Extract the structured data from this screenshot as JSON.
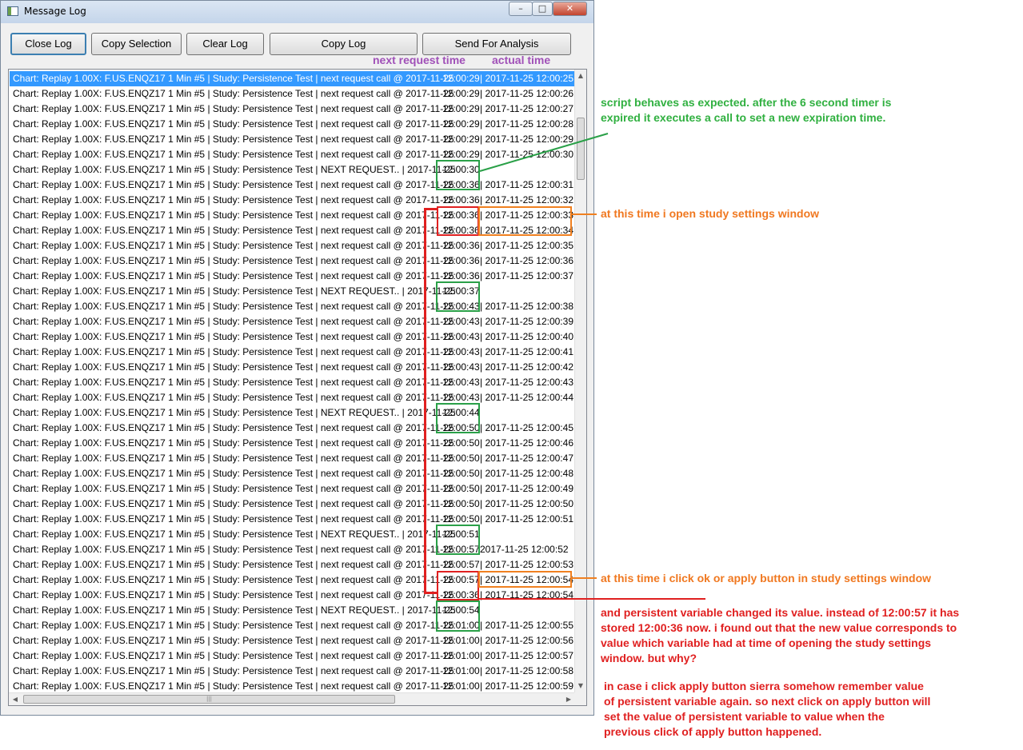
{
  "window": {
    "title": "Message Log",
    "minimize": "–",
    "maximize": "□",
    "close": "✕"
  },
  "toolbar": {
    "close_log": "Close Log",
    "copy_selection": "Copy Selection",
    "clear_log": "Clear Log",
    "copy_log": "Copy Log",
    "send_for_analysis": "Send For Analysis"
  },
  "column_annotations": {
    "next_request_time": "next request time",
    "actual_time": "actual time"
  },
  "log": {
    "rows": [
      {
        "p": "Chart: Replay 1.00X: F.US.ENQZ17  1 Min   #5 | Study: Persistence Test | next request call @ 2017-11-25",
        "t1": "12:00:29",
        "t2": "| 2017-11-25  12:00:25",
        "sel": true
      },
      {
        "p": "Chart: Replay 1.00X: F.US.ENQZ17  1 Min   #5 | Study: Persistence Test | next request call @ 2017-11-25",
        "t1": "12:00:29",
        "t2": "| 2017-11-25  12:00:26"
      },
      {
        "p": "Chart: Replay 1.00X: F.US.ENQZ17  1 Min   #5 | Study: Persistence Test | next request call @ 2017-11-25",
        "t1": "12:00:29",
        "t2": "| 2017-11-25  12:00:27"
      },
      {
        "p": "Chart: Replay 1.00X: F.US.ENQZ17  1 Min   #5 | Study: Persistence Test | next request call @ 2017-11-25",
        "t1": "12:00:29",
        "t2": "| 2017-11-25  12:00:28"
      },
      {
        "p": "Chart: Replay 1.00X: F.US.ENQZ17  1 Min   #5 | Study: Persistence Test | next request call @ 2017-11-25",
        "t1": "12:00:29",
        "t2": "| 2017-11-25  12:00:29"
      },
      {
        "p": "Chart: Replay 1.00X: F.US.ENQZ17  1 Min   #5 | Study: Persistence Test | next request call @ 2017-11-25",
        "t1": "12:00:29",
        "t2": "| 2017-11-25  12:00:30"
      },
      {
        "p": "Chart: Replay 1.00X: F.US.ENQZ17  1 Min   #5 | Study: Persistence Test | NEXT REQUEST..  | 2017-11-25",
        "t1": "12:00:30",
        "t2": ""
      },
      {
        "p": "Chart: Replay 1.00X: F.US.ENQZ17  1 Min   #5 | Study: Persistence Test | next request call @ 2017-11-25",
        "t1": "12:00:36",
        "t2": "| 2017-11-25  12:00:31"
      },
      {
        "p": "Chart: Replay 1.00X: F.US.ENQZ17  1 Min   #5 | Study: Persistence Test | next request call @ 2017-11-25",
        "t1": "12:00:36",
        "t2": "| 2017-11-25  12:00:32"
      },
      {
        "p": "Chart: Replay 1.00X: F.US.ENQZ17  1 Min   #5 | Study: Persistence Test | next request call @ 2017-11-25",
        "t1": "12:00:36",
        "t2": "| 2017-11-25  12:00:33"
      },
      {
        "p": "Chart: Replay 1.00X: F.US.ENQZ17  1 Min   #5 | Study: Persistence Test | next request call @ 2017-11-25",
        "t1": "12:00:36",
        "t2": "| 2017-11-25  12:00:34"
      },
      {
        "p": "Chart: Replay 1.00X: F.US.ENQZ17  1 Min   #5 | Study: Persistence Test | next request call @ 2017-11-25",
        "t1": "12:00:36",
        "t2": "| 2017-11-25  12:00:35"
      },
      {
        "p": "Chart: Replay 1.00X: F.US.ENQZ17  1 Min   #5 | Study: Persistence Test | next request call @ 2017-11-25",
        "t1": "12:00:36",
        "t2": "| 2017-11-25  12:00:36"
      },
      {
        "p": "Chart: Replay 1.00X: F.US.ENQZ17  1 Min   #5 | Study: Persistence Test | next request call @ 2017-11-25",
        "t1": "12:00:36",
        "t2": "| 2017-11-25  12:00:37"
      },
      {
        "p": "Chart: Replay 1.00X: F.US.ENQZ17  1 Min   #5 | Study: Persistence Test | NEXT REQUEST..  | 2017-11-25",
        "t1": "12:00:37",
        "t2": ""
      },
      {
        "p": "Chart: Replay 1.00X: F.US.ENQZ17  1 Min   #5 | Study: Persistence Test | next request call @ 2017-11-25",
        "t1": "12:00:43",
        "t2": "| 2017-11-25  12:00:38"
      },
      {
        "p": "Chart: Replay 1.00X: F.US.ENQZ17  1 Min   #5 | Study: Persistence Test | next request call @ 2017-11-25",
        "t1": "12:00:43",
        "t2": "| 2017-11-25  12:00:39"
      },
      {
        "p": "Chart: Replay 1.00X: F.US.ENQZ17  1 Min   #5 | Study: Persistence Test | next request call @ 2017-11-25",
        "t1": "12:00:43",
        "t2": "| 2017-11-25  12:00:40"
      },
      {
        "p": "Chart: Replay 1.00X: F.US.ENQZ17  1 Min   #5 | Study: Persistence Test | next request call @ 2017-11-25",
        "t1": "12:00:43",
        "t2": "| 2017-11-25  12:00:41"
      },
      {
        "p": "Chart: Replay 1.00X: F.US.ENQZ17  1 Min   #5 | Study: Persistence Test | next request call @ 2017-11-25",
        "t1": "12:00:43",
        "t2": "| 2017-11-25  12:00:42"
      },
      {
        "p": "Chart: Replay 1.00X: F.US.ENQZ17  1 Min   #5 | Study: Persistence Test | next request call @ 2017-11-25",
        "t1": "12:00:43",
        "t2": "| 2017-11-25  12:00:43"
      },
      {
        "p": "Chart: Replay 1.00X: F.US.ENQZ17  1 Min   #5 | Study: Persistence Test | next request call @ 2017-11-25",
        "t1": "12:00:43",
        "t2": "| 2017-11-25  12:00:44"
      },
      {
        "p": "Chart: Replay 1.00X: F.US.ENQZ17  1 Min   #5 | Study: Persistence Test | NEXT REQUEST..  | 2017-11-25",
        "t1": "12:00:44",
        "t2": ""
      },
      {
        "p": "Chart: Replay 1.00X: F.US.ENQZ17  1 Min   #5 | Study: Persistence Test | next request call @ 2017-11-25",
        "t1": "12:00:50",
        "t2": "| 2017-11-25  12:00:45"
      },
      {
        "p": "Chart: Replay 1.00X: F.US.ENQZ17  1 Min   #5 | Study: Persistence Test | next request call @ 2017-11-25",
        "t1": "12:00:50",
        "t2": "| 2017-11-25  12:00:46"
      },
      {
        "p": "Chart: Replay 1.00X: F.US.ENQZ17  1 Min   #5 | Study: Persistence Test | next request call @ 2017-11-25",
        "t1": "12:00:50",
        "t2": "| 2017-11-25  12:00:47"
      },
      {
        "p": "Chart: Replay 1.00X: F.US.ENQZ17  1 Min   #5 | Study: Persistence Test | next request call @ 2017-11-25",
        "t1": "12:00:50",
        "t2": "| 2017-11-25  12:00:48"
      },
      {
        "p": "Chart: Replay 1.00X: F.US.ENQZ17  1 Min   #5 | Study: Persistence Test | next request call @ 2017-11-25",
        "t1": "12:00:50",
        "t2": "| 2017-11-25  12:00:49"
      },
      {
        "p": "Chart: Replay 1.00X: F.US.ENQZ17  1 Min   #5 | Study: Persistence Test | next request call @ 2017-11-25",
        "t1": "12:00:50",
        "t2": "| 2017-11-25  12:00:50"
      },
      {
        "p": "Chart: Replay 1.00X: F.US.ENQZ17  1 Min   #5 | Study: Persistence Test | next request call @ 2017-11-25",
        "t1": "12:00:50",
        "t2": "| 2017-11-25  12:00:51"
      },
      {
        "p": "Chart: Replay 1.00X: F.US.ENQZ17  1 Min   #5 | Study: Persistence Test | NEXT REQUEST..  | 2017-11-25",
        "t1": "12:00:51",
        "t2": ""
      },
      {
        "p": "Chart: Replay 1.00X: F.US.ENQZ17  1 Min   #5 | Study: Persistence Test | next request call @ 2017-11-25",
        "t1": "12:00:57",
        "t2": "  2017-11-25  12:00:52"
      },
      {
        "p": "Chart: Replay 1.00X: F.US.ENQZ17  1 Min   #5 | Study: Persistence Test | next request call @ 2017-11-25",
        "t1": "12:00:57",
        "t2": "| 2017-11-25  12:00:53"
      },
      {
        "p": "Chart: Replay 1.00X: F.US.ENQZ17  1 Min   #5 | Study: Persistence Test | next request call @ 2017-11-25",
        "t1": "12:00:57",
        "t2": "| 2017-11-25  12:00:54"
      },
      {
        "p": "Chart: Replay 1.00X: F.US.ENQZ17  1 Min   #5 | Study: Persistence Test | next request call @ 2017-11-25",
        "t1": "12:00:36",
        "t2": "| 2017-11-25  12:00:54"
      },
      {
        "p": "Chart: Replay 1.00X: F.US.ENQZ17  1 Min   #5 | Study: Persistence Test | NEXT REQUEST..  | 2017-11-25",
        "t1": "12:00:54",
        "t2": ""
      },
      {
        "p": "Chart: Replay 1.00X: F.US.ENQZ17  1 Min   #5 | Study: Persistence Test | next request call @ 2017-11-25",
        "t1": "12:01:00",
        "t2": "| 2017-11-25  12:00:55"
      },
      {
        "p": "Chart: Replay 1.00X: F.US.ENQZ17  1 Min   #5 | Study: Persistence Test | next request call @ 2017-11-25",
        "t1": "12:01:00",
        "t2": "| 2017-11-25  12:00:56"
      },
      {
        "p": "Chart: Replay 1.00X: F.US.ENQZ17  1 Min   #5 | Study: Persistence Test | next request call @ 2017-11-25",
        "t1": "12:01:00",
        "t2": "| 2017-11-25  12:00:57"
      },
      {
        "p": "Chart: Replay 1.00X: F.US.ENQZ17  1 Min   #5 | Study: Persistence Test | next request call @ 2017-11-25",
        "t1": "12:01:00",
        "t2": "| 2017-11-25  12:00:58"
      },
      {
        "p": "Chart: Replay 1.00X: F.US.ENQZ17  1 Min   #5 | Study: Persistence Test | next request call @ 2017-11-25",
        "t1": "12:01:00",
        "t2": "| 2017-11-25  12:00:59"
      }
    ],
    "hscroll_grip": "|||"
  },
  "notes": {
    "script_behaves": "script behaves as expected. after the 6 second timer is\nexpired it executes a call to set a new expiration time.",
    "open_settings": "at this time i open study settings window",
    "click_ok": "at this time i click ok or apply button in study settings window",
    "persistent_changed": "and persistent variable changed its value. instead of 12:00:57 it has\nstored 12:00:36 now. i found out that the new value corresponds to\nvalue which variable had at time of opening the study settings\nwindow. but why?",
    "apply_again": "in case i click apply button sierra somehow remember value\nof persistent variable again. so next click on apply button will\nset the value of persistent variable to value when the\nprevious click of apply button happened."
  },
  "colors": {
    "green": "#2aa048",
    "red": "#e02020",
    "orange": "#f08020",
    "purple": "#a050b8",
    "selection": "#3399ff"
  }
}
